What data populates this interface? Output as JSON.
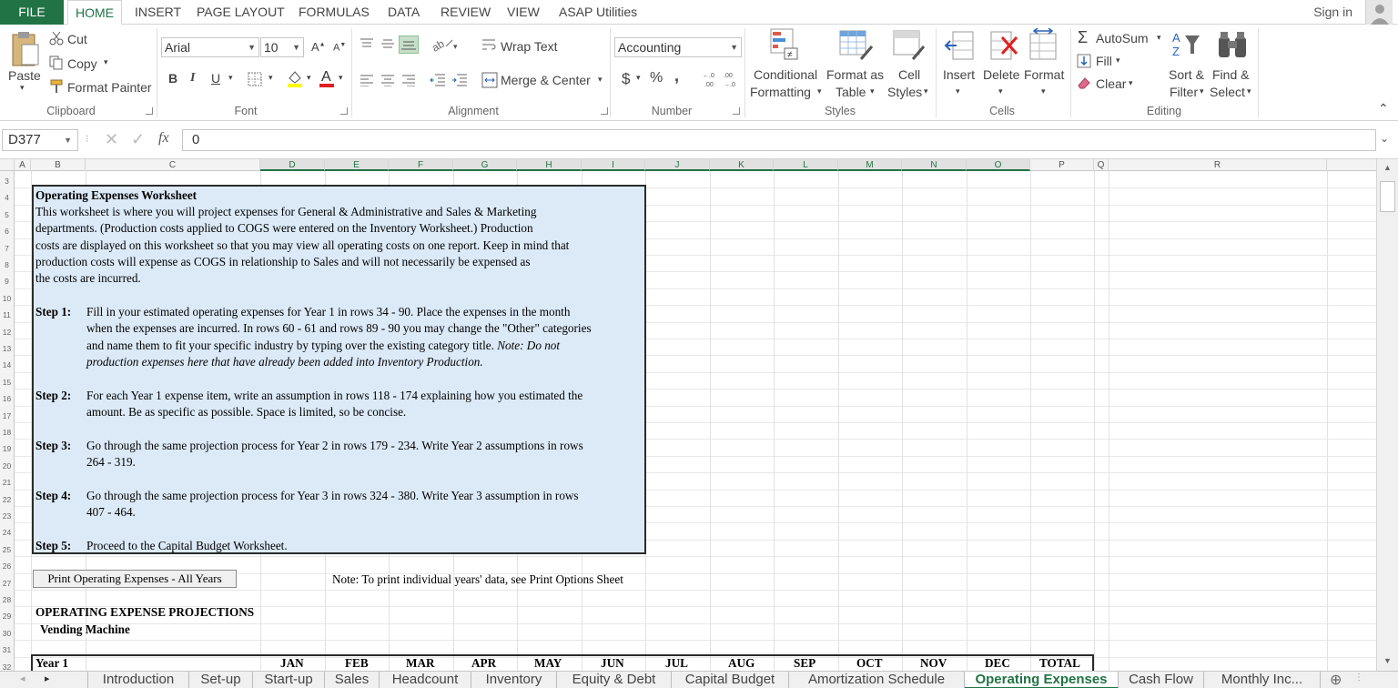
{
  "ribbon_tabs": {
    "file": "FILE",
    "items": [
      "HOME",
      "INSERT",
      "PAGE LAYOUT",
      "FORMULAS",
      "DATA",
      "REVIEW",
      "VIEW",
      "ASAP Utilities"
    ],
    "active": "HOME"
  },
  "account": {
    "sign_in": "Sign in"
  },
  "clipboard": {
    "paste": "Paste",
    "cut": "Cut",
    "copy": "Copy",
    "format_painter": "Format Painter",
    "label": "Clipboard"
  },
  "font": {
    "family": "Arial",
    "size": "10",
    "bold": "B",
    "italic": "I",
    "underline": "U",
    "label": "Font"
  },
  "alignment": {
    "wrap_text": "Wrap Text",
    "merge_center": "Merge & Center",
    "label": "Alignment"
  },
  "number": {
    "format": "Accounting",
    "currency": "$",
    "percent": "%",
    "comma": ",",
    "inc_dec": ".00",
    "dec_dec": ".0",
    "label": "Number"
  },
  "styles": {
    "conditional_1": "Conditional",
    "conditional_2": "Formatting",
    "format_table_1": "Format as",
    "format_table_2": "Table",
    "cell_styles_1": "Cell",
    "cell_styles_2": "Styles",
    "label": "Styles"
  },
  "cells": {
    "insert": "Insert",
    "delete": "Delete",
    "format": "Format",
    "label": "Cells"
  },
  "editing": {
    "autosum": "AutoSum",
    "fill": "Fill",
    "clear": "Clear",
    "sort_1": "Sort &",
    "sort_2": "Filter",
    "find_1": "Find &",
    "find_2": "Select",
    "label": "Editing"
  },
  "formula_bar": {
    "name_box": "D377",
    "fx": "fx",
    "value": "0"
  },
  "columns": [
    "A",
    "B",
    "C",
    "D",
    "E",
    "F",
    "G",
    "H",
    "I",
    "J",
    "K",
    "L",
    "M",
    "N",
    "O",
    "P",
    "Q",
    "R"
  ],
  "rows": [
    "3",
    "4",
    "5",
    "6",
    "7",
    "8",
    "9",
    "10",
    "11",
    "12",
    "13",
    "14",
    "15",
    "16",
    "17",
    "18",
    "19",
    "20",
    "21",
    "22",
    "23",
    "24",
    "25",
    "26",
    "27",
    "28",
    "29",
    "30",
    "31",
    "32"
  ],
  "worksheet": {
    "title": "Operating Expenses Worksheet",
    "intro_lines": [
      "This worksheet is where you will project expenses for General & Administrative and Sales & Marketing",
      "departments.  (Production costs applied to COGS were entered on the Inventory Worksheet.)  Production",
      "costs are displayed on this worksheet so that you may view all operating costs on one report.  Keep in mind that",
      "production costs will expense as COGS in relationship to Sales and will not necessarily be expensed as",
      "the costs are incurred."
    ],
    "step1_label": "Step 1:",
    "step1_lines": [
      "Fill in your estimated operating expenses for Year 1 in rows 34 - 90. Place the expenses in the month",
      "when the expenses are incurred. In rows 60 - 61 and rows 89 - 90 you may change the \"Other\" categories",
      "and name them to fit your specific industry by typing over the existing category title."
    ],
    "step1_note_a": "Note:  Do not",
    "step1_note_b": "production expenses here that have already been added into Inventory Production.",
    "step2_label": "Step 2:",
    "step2_lines": [
      "For each Year 1 expense item, write an assumption in rows 118 - 174 explaining how you estimated the",
      "amount. Be as specific as possible. Space is limited, so be concise."
    ],
    "step3_label": "Step 3:",
    "step3_lines": [
      "Go through the same projection process for Year 2 in rows 179 - 234. Write Year 2 assumptions in rows",
      "264 - 319."
    ],
    "step4_label": "Step 4:",
    "step4_lines": [
      "Go through the same projection process for Year 3 in rows 324 - 380. Write Year 3 assumption in rows",
      "407 - 464."
    ],
    "step5_label": "Step 5:",
    "step5_text": "Proceed to the Capital Budget Worksheet.",
    "print_button": "Print Operating Expenses - All Years",
    "print_note": "Note:  To print individual years' data, see Print Options Sheet",
    "projections_title": "OPERATING EXPENSE PROJECTIONS",
    "business": "Vending Machine",
    "year_label": "Year 1",
    "months": [
      "JAN",
      "FEB",
      "MAR",
      "APR",
      "MAY",
      "JUN",
      "JUL",
      "AUG",
      "SEP",
      "OCT",
      "NOV",
      "DEC",
      "TOTAL"
    ]
  },
  "sheet_tabs": [
    "Introduction",
    "Set-up",
    "Start-up",
    "Sales",
    "Headcount",
    "Inventory",
    "Equity & Debt",
    "Capital Budget",
    "Amortization Schedule",
    "Operating Expenses",
    "Cash Flow",
    "Monthly Inc..."
  ],
  "active_sheet": "Operating Expenses",
  "colors": {
    "accent": "#217346",
    "info_box": "#dceaf8"
  }
}
